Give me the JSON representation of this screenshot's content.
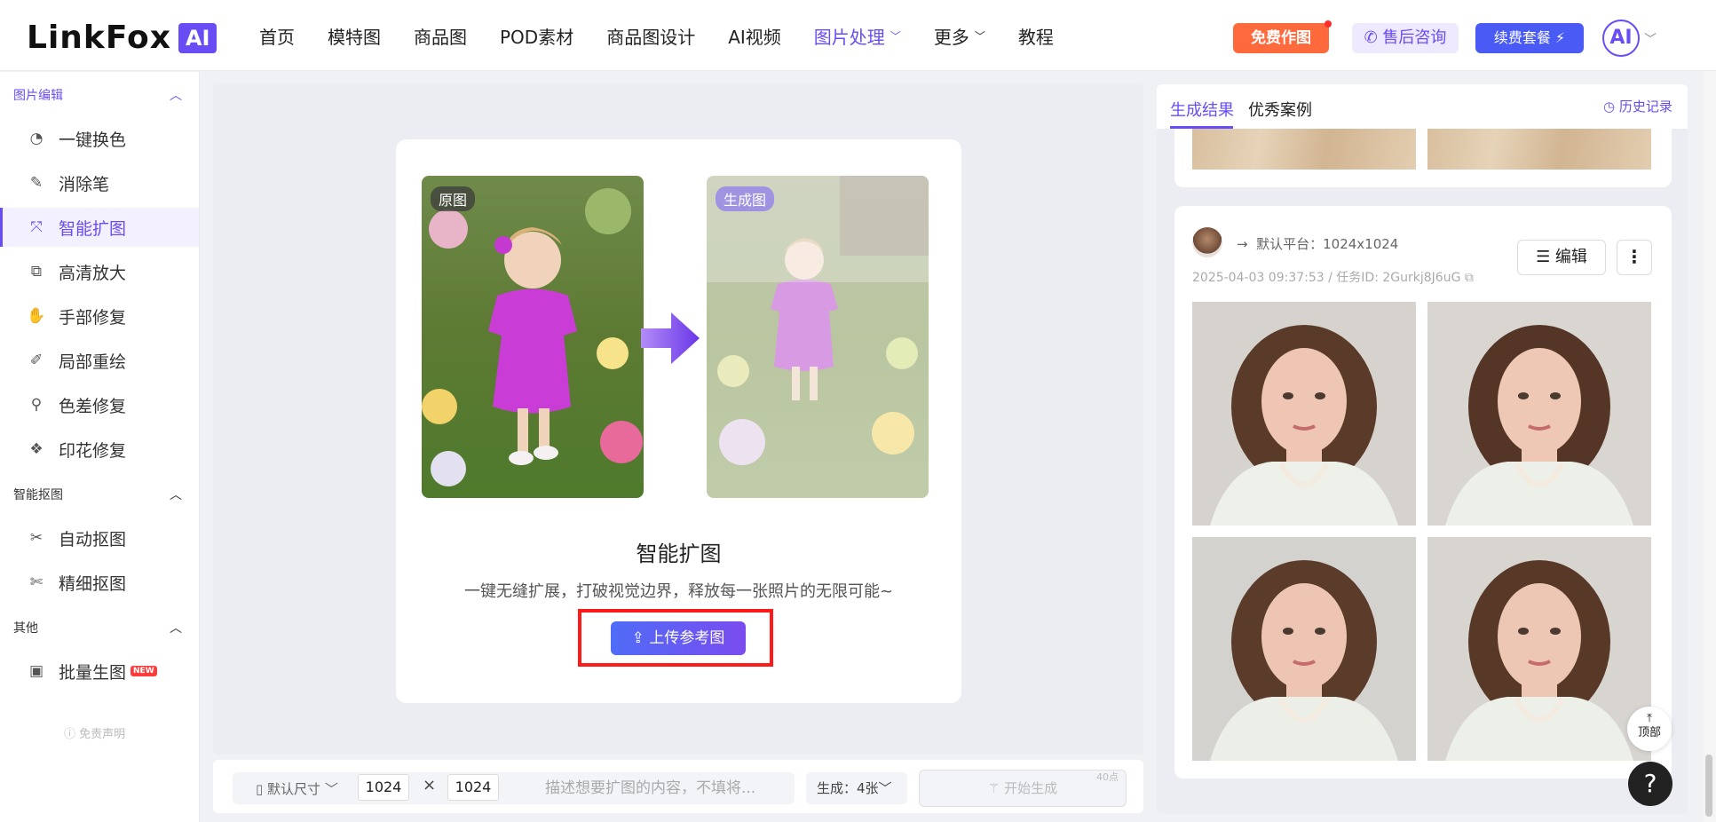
{
  "brand": {
    "name": "LinkFox",
    "badge": "AI"
  },
  "nav": {
    "items": [
      "首页",
      "模特图",
      "商品图",
      "POD素材",
      "商品图设计",
      "AI视频",
      "图片处理",
      "更多",
      "教程"
    ],
    "active": "图片处理",
    "free_btn": "免费作图",
    "service_btn": "售后咨询",
    "renew_btn": "续费套餐",
    "avatar_text": "AI"
  },
  "sidebar": {
    "sections": [
      {
        "title": "图片编辑",
        "items": [
          "一键换色",
          "消除笔",
          "智能扩图",
          "高清放大",
          "手部修复",
          "局部重绘",
          "色差修复",
          "印花修复"
        ]
      },
      {
        "title": "智能抠图",
        "items": [
          "自动抠图",
          "精细抠图"
        ]
      },
      {
        "title": "其他",
        "items": [
          "批量生图"
        ]
      }
    ],
    "active_item": "智能扩图",
    "new_badge": "NEW",
    "disclaimer": "免责声明"
  },
  "card": {
    "tag_original": "原图",
    "tag_generated": "生成图",
    "title": "智能扩图",
    "description": "一键无缝扩展，打破视觉边界，释放每一张照片的无限可能~",
    "upload_button": "上传参考图"
  },
  "toolbar": {
    "size_label": "默认尺寸",
    "width": "1024",
    "times": "×",
    "height": "1024",
    "prompt_placeholder": "描述想要扩图的内容，不填将...",
    "generate_label": "生成：4张",
    "start_button": "开始生成",
    "cost": "40点"
  },
  "right": {
    "tab_results": "生成结果",
    "tab_examples": "优秀案例",
    "history": "历史记录",
    "result": {
      "platform": "默认平台：1024x1024",
      "meta": "2025-04-03 09:37:53 / 任务ID: 2Gurkj8J6uG",
      "edit_button": "编辑",
      "more_button": "⋮"
    },
    "to_top": "顶部",
    "help": "?"
  },
  "colors": {
    "accent": "#6a4cf5",
    "orange": "#ff6a3d",
    "blue": "#4a5bf5",
    "highlight_red": "#ff1a1a"
  }
}
